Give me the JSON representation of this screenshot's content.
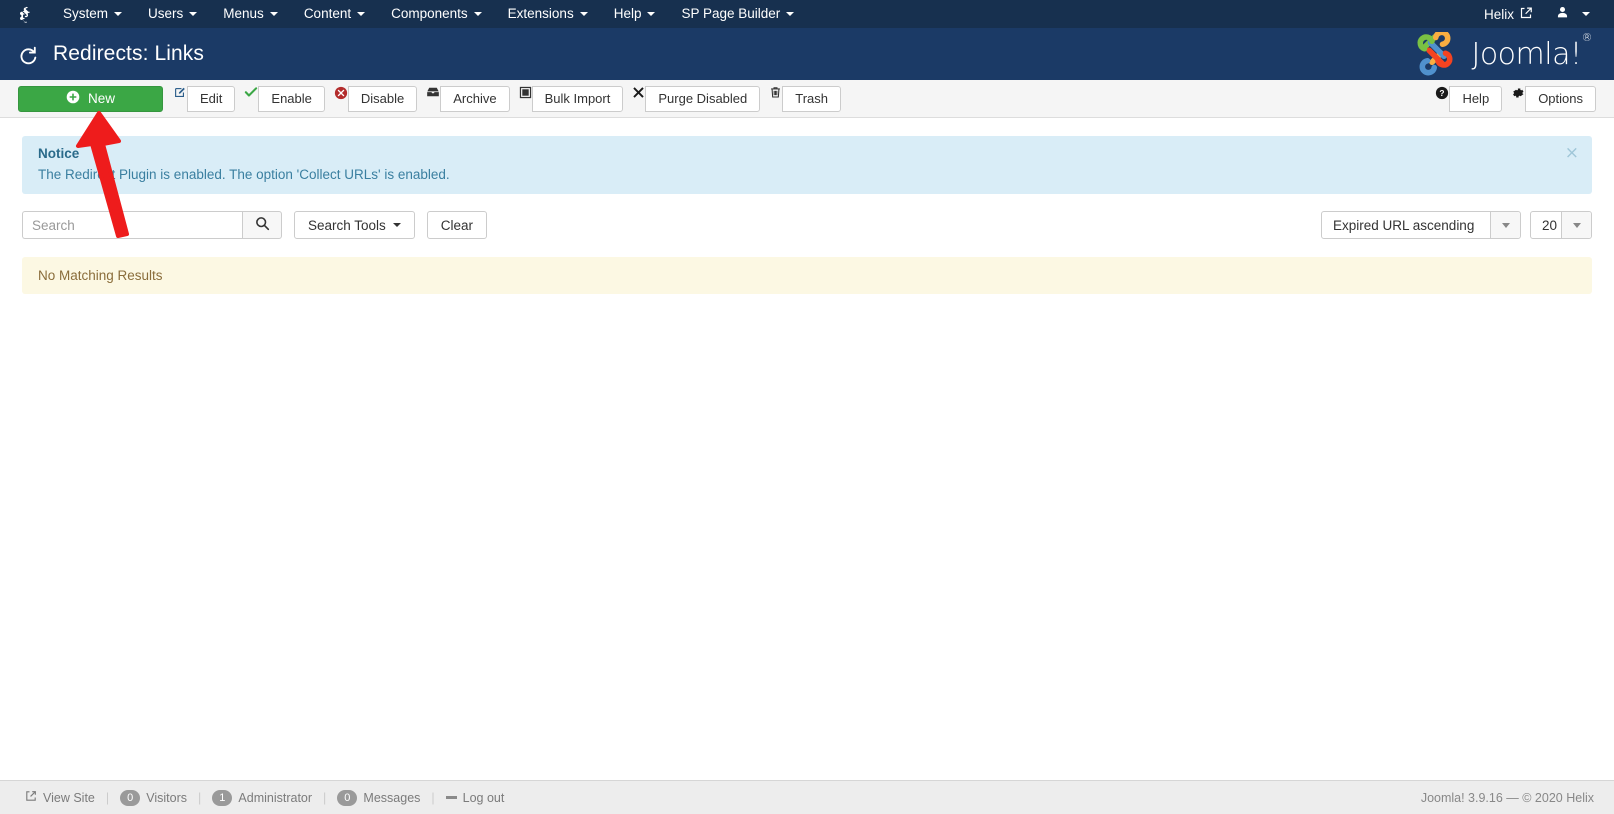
{
  "topbar": {
    "brand_icon": "joomla-logo-icon",
    "menu": [
      {
        "label": "System",
        "has_caret": true
      },
      {
        "label": "Users",
        "has_caret": true
      },
      {
        "label": "Menus",
        "has_caret": true
      },
      {
        "label": "Content",
        "has_caret": true
      },
      {
        "label": "Components",
        "has_caret": true
      },
      {
        "label": "Extensions",
        "has_caret": true
      },
      {
        "label": "Help",
        "has_caret": true
      },
      {
        "label": "SP Page Builder",
        "has_caret": true
      }
    ],
    "site_name": "Helix",
    "site_icon": "external-link-icon",
    "user_icon": "user-icon"
  },
  "header": {
    "icon": "redo-arrow-icon",
    "title": "Redirects: Links",
    "logo_text": "Joomla!",
    "logo_sup": "®"
  },
  "toolbar": {
    "new_label": "New",
    "new_icon": "plus-circle-icon",
    "new_color": "#3ba745",
    "buttons": [
      {
        "label": "Edit",
        "icon": "edit-pencil-icon"
      },
      {
        "label": "Enable",
        "icon": "check-icon"
      },
      {
        "label": "Disable",
        "icon": "times-circle-icon"
      },
      {
        "label": "Archive",
        "icon": "archive-box-icon"
      },
      {
        "label": "Bulk Import",
        "icon": "bulk-import-icon"
      },
      {
        "label": "Purge Disabled",
        "icon": "times-icon"
      },
      {
        "label": "Trash",
        "icon": "trash-icon"
      }
    ],
    "right_buttons": [
      {
        "label": "Help",
        "icon": "question-circle-icon"
      },
      {
        "label": "Options",
        "icon": "gear-icon"
      }
    ]
  },
  "notice": {
    "title": "Notice",
    "message": "The Redirect Plugin is enabled. The option 'Collect URLs' is enabled.",
    "close_icon": "close-icon",
    "bg_color": "#d9edf7",
    "text_color": "#31708f"
  },
  "filters": {
    "search_placeholder": "Search",
    "search_value": "",
    "search_icon": "search-icon",
    "search_tools_label": "Search Tools",
    "clear_label": "Clear",
    "sort_value": "Expired URL ascending",
    "limit_value": "20"
  },
  "results": {
    "empty_message": "No Matching Results",
    "bg_color": "#fcf8e3",
    "text_color": "#8a6d3b"
  },
  "footer": {
    "view_site_label": "View Site",
    "view_site_icon": "external-link-icon",
    "visitors_count": "0",
    "visitors_label": "Visitors",
    "administrator_count": "1",
    "administrator_label": "Administrator",
    "messages_count": "0",
    "messages_label": "Messages",
    "logout_label": "Log out",
    "logout_icon": "minus-icon",
    "copyright": "Joomla! 3.9.16  —  © 2020 Helix"
  },
  "annotation": {
    "type": "arrow",
    "color": "#ee1c1c",
    "points_to": "new-button"
  }
}
